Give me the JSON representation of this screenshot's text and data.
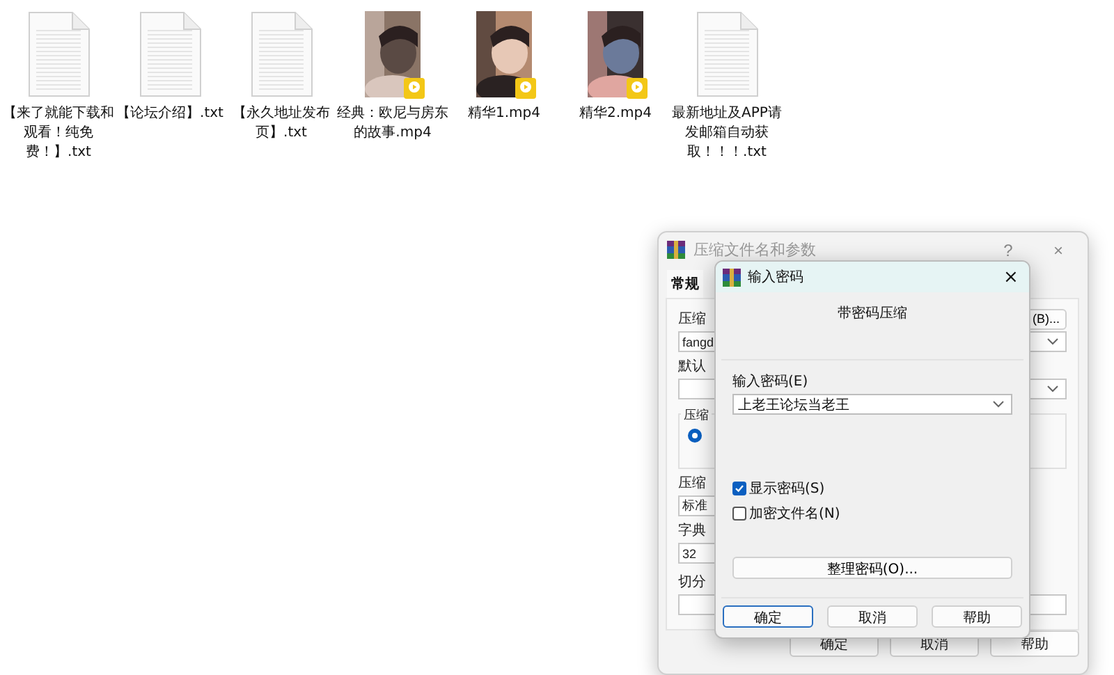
{
  "files": [
    {
      "name": "【来了就能下载和观看！纯免费！】.txt",
      "kind": "text"
    },
    {
      "name": "【论坛介绍】.txt",
      "kind": "text"
    },
    {
      "name": "【永久地址发布页】.txt",
      "kind": "text"
    },
    {
      "name": "经典：欧尼与房东的故事.mp4",
      "kind": "video"
    },
    {
      "name": "精华1.mp4",
      "kind": "video"
    },
    {
      "name": "精华2.mp4",
      "kind": "video"
    },
    {
      "name": "最新地址及APP请发邮箱自动获取！！！.txt",
      "kind": "text"
    }
  ],
  "archive_dialog": {
    "title": "压缩文件名和参数",
    "help": "?",
    "close": "×",
    "tabs": [
      {
        "label": "常规",
        "selected": true
      }
    ],
    "archive_name_label": "压缩",
    "browse_button": "(B)...",
    "archive_name_value": "fangd",
    "profile_label": "默认",
    "format_group_label": "压缩",
    "format_radio": {
      "selected": true
    },
    "method_label": "压缩",
    "method_value": "标准",
    "dictionary_label": "字典",
    "dictionary_value": "32",
    "split_label": "切分",
    "buttons": [
      "确定",
      "取消",
      "帮助"
    ]
  },
  "password_dialog": {
    "title": "输入密码",
    "close": "×",
    "heading": "带密码压缩",
    "password_label": "输入密码(E)",
    "password_value": "上老王论坛当老王",
    "options": [
      {
        "label": "显示密码(S)",
        "checked": true
      },
      {
        "label": "加密文件名(N)",
        "checked": false
      }
    ],
    "organize_button": "整理密码(O)...",
    "buttons": [
      {
        "label": "确定",
        "selected": true
      },
      {
        "label": "取消",
        "selected": false
      },
      {
        "label": "帮助",
        "selected": false
      }
    ]
  }
}
